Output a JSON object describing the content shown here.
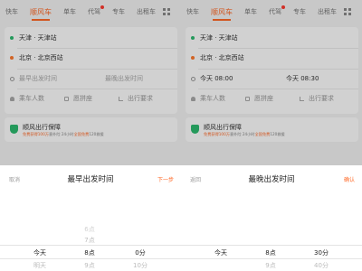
{
  "panels": [
    {
      "tabs": [
        "快车",
        "顺风车",
        "单车",
        "代驾",
        "专车",
        "出租车"
      ],
      "active_tab": 1,
      "badge_tab": 3,
      "from": "天津 · 天津站",
      "to": "北京 · 北京西站",
      "earliest": "最早出发时间",
      "latest": "最晚出发时间",
      "passengers": "乘车人数",
      "seat": "愿拼座",
      "requirements": "出行要求",
      "insurance_title": "顺风出行保障",
      "insurance_desc_pre": "免费获得",
      "insurance_desc_hl": "100万",
      "insurance_desc_mid": "意外险 24小时",
      "insurance_desc_hl2": "全国免费",
      "insurance_desc_post": "120救援",
      "sheet_left": "取消",
      "sheet_title": "最早出发时间",
      "sheet_right": "下一步",
      "picker": {
        "day": [
          "今天",
          "明天"
        ],
        "hour_above": [
          "6点",
          "7点"
        ],
        "hour": [
          "8点",
          "9点"
        ],
        "minute": [
          "0分",
          "10分"
        ]
      }
    },
    {
      "tabs": [
        "快车",
        "顺风车",
        "单车",
        "代驾",
        "专车",
        "出租车"
      ],
      "active_tab": 1,
      "badge_tab": 3,
      "from": "天津 · 天津站",
      "to": "北京 · 北京西站",
      "earliest": "今天 08:00",
      "latest": "今天 08:30",
      "passengers": "乘车人数",
      "seat": "愿拼座",
      "requirements": "出行要求",
      "insurance_title": "顺风出行保障",
      "insurance_desc_pre": "免费获得",
      "insurance_desc_hl": "100万",
      "insurance_desc_mid": "意外险 24小时",
      "insurance_desc_hl2": "全国免费",
      "insurance_desc_post": "120救援",
      "sheet_left": "返回",
      "sheet_title": "最晚出发时间",
      "sheet_right": "确认",
      "picker": {
        "day": [
          "今天",
          ""
        ],
        "hour_above": [
          "",
          ""
        ],
        "hour": [
          "8点",
          "9点"
        ],
        "minute": [
          "30分",
          "40分"
        ]
      }
    }
  ],
  "colors": {
    "accent": "#ff6a28",
    "green": "#2dbb70",
    "badge": "#ff3b30"
  }
}
